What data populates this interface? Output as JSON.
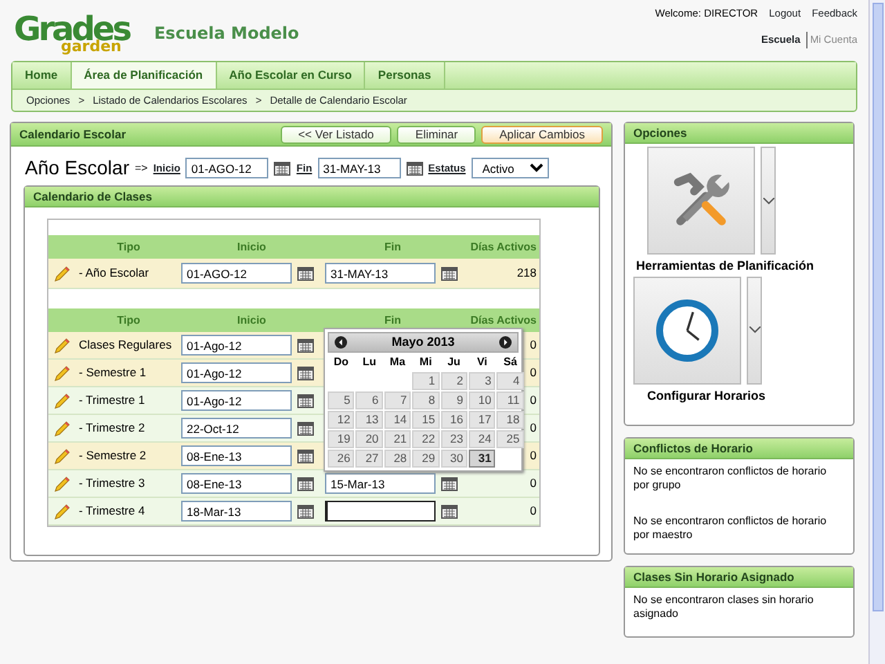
{
  "header": {
    "logo_top": "Grades",
    "logo_bottom": "garden",
    "school": "Escuela Modelo",
    "welcome": "Welcome: DIRECTOR",
    "links": [
      "Logout",
      "Feedback"
    ],
    "switch": [
      {
        "label": "Escuela",
        "selected": true
      },
      {
        "label": "Mi Cuenta",
        "selected": false
      }
    ]
  },
  "tabs": [
    {
      "label": "Home",
      "selected": false
    },
    {
      "label": "Área de Planificación",
      "selected": true
    },
    {
      "label": "Año Escolar en Curso",
      "selected": false
    },
    {
      "label": "Personas",
      "selected": false
    }
  ],
  "breadcrumb": {
    "items": [
      "Opciones",
      "Listado de Calendarios Escolares",
      "Detalle de Calendario Escolar"
    ],
    "separators": [
      ">",
      ">"
    ]
  },
  "main": {
    "title": "Calendario Escolar",
    "buttons": [
      {
        "label": "<< Ver Listado",
        "kind": "plain"
      },
      {
        "label": "Eliminar",
        "kind": "plain"
      },
      {
        "label": "Aplicar Cambios",
        "kind": "primary"
      }
    ],
    "year": {
      "label": "Año Escolar",
      "arrow": "=>",
      "inicio_label": "Inicio",
      "inicio": "01-AGO-12",
      "fin_label": "Fin",
      "fin": "31-MAY-13",
      "estatus_label": "Estatus",
      "estatus": "Activo"
    },
    "calendar": {
      "title": "Calendario de Clases",
      "columns": [
        "Tipo",
        "Inicio",
        "Fin",
        "Días Activos"
      ],
      "year_row": {
        "tipo": "- Año Escolar",
        "inicio": "01-AGO-12",
        "fin": "31-MAY-13",
        "dias": "218"
      },
      "columns_2": [
        "Tipo",
        "Inicio",
        "Fin",
        "Días Activos"
      ],
      "periods": [
        {
          "tipo": "Clases Regulares",
          "inicio": "01-Ago-12",
          "dias": "0",
          "kind": "semester"
        },
        {
          "tipo": "- Semestre 1",
          "inicio": "01-Ago-12",
          "dias": "0",
          "kind": "semester"
        },
        {
          "tipo": "- Trimestre 1",
          "inicio": "01-Ago-12",
          "dias": "0",
          "kind": "trimester"
        },
        {
          "tipo": "- Trimestre 2",
          "inicio": "22-Oct-12",
          "dias": "0",
          "kind": "trimester"
        },
        {
          "tipo": "- Semestre 2",
          "inicio": "08-Ene-13",
          "dias": "0",
          "kind": "semester"
        },
        {
          "tipo": "- Trimestre 3",
          "inicio": "08-Ene-13",
          "fin": "15-Mar-13",
          "dias": "0",
          "kind": "trimester"
        },
        {
          "tipo": "- Trimestre 4",
          "inicio": "18-Mar-13",
          "dias": "0",
          "kind": "trimester",
          "focused": true
        }
      ],
      "datepicker": {
        "month": "Mayo 2013",
        "weekdays": [
          "Do",
          "Lu",
          "Ma",
          "Mi",
          "Ju",
          "Vi",
          "Sá"
        ],
        "weeks": [
          [
            {
              "kind": "blank"
            },
            {
              "kind": "blank"
            },
            {
              "kind": "blank"
            },
            {
              "kind": "day",
              "day": "1",
              "selected": false
            },
            {
              "kind": "day",
              "day": "2",
              "selected": false
            },
            {
              "kind": "day",
              "day": "3",
              "selected": false
            },
            {
              "kind": "day",
              "day": "4",
              "selected": false
            }
          ],
          [
            {
              "kind": "day",
              "day": "5",
              "selected": false
            },
            {
              "kind": "day",
              "day": "6",
              "selected": false
            },
            {
              "kind": "day",
              "day": "7",
              "selected": false
            },
            {
              "kind": "day",
              "day": "8",
              "selected": false
            },
            {
              "kind": "day",
              "day": "9",
              "selected": false
            },
            {
              "kind": "day",
              "day": "10",
              "selected": false
            },
            {
              "kind": "day",
              "day": "11",
              "selected": false
            }
          ],
          [
            {
              "kind": "day",
              "day": "12",
              "selected": false
            },
            {
              "kind": "day",
              "day": "13",
              "selected": false
            },
            {
              "kind": "day",
              "day": "14",
              "selected": false
            },
            {
              "kind": "day",
              "day": "15",
              "selected": false
            },
            {
              "kind": "day",
              "day": "16",
              "selected": false
            },
            {
              "kind": "day",
              "day": "17",
              "selected": false
            },
            {
              "kind": "day",
              "day": "18",
              "selected": false
            }
          ],
          [
            {
              "kind": "day",
              "day": "19",
              "selected": false
            },
            {
              "kind": "day",
              "day": "20",
              "selected": false
            },
            {
              "kind": "day",
              "day": "21",
              "selected": false
            },
            {
              "kind": "day",
              "day": "22",
              "selected": false
            },
            {
              "kind": "day",
              "day": "23",
              "selected": false
            },
            {
              "kind": "day",
              "day": "24",
              "selected": false
            },
            {
              "kind": "day",
              "day": "25",
              "selected": false
            }
          ],
          [
            {
              "kind": "day",
              "day": "26",
              "selected": false
            },
            {
              "kind": "day",
              "day": "27",
              "selected": false
            },
            {
              "kind": "day",
              "day": "28",
              "selected": false
            },
            {
              "kind": "day",
              "day": "29",
              "selected": false
            },
            {
              "kind": "day",
              "day": "30",
              "selected": false
            },
            {
              "kind": "day",
              "day": "31",
              "selected": true
            }
          ]
        ]
      }
    }
  },
  "options": {
    "title": "Opciones",
    "items": [
      {
        "label": "Herramientas de Planificación",
        "kind": "tools"
      },
      {
        "label": "Configurar Horarios",
        "kind": "clock"
      }
    ]
  },
  "conflicts": {
    "title": "Conflictos de Horario",
    "messages": [
      "No se encontraron conflictos de horario por grupo",
      "No se encontraron conflictos de horario por maestro"
    ]
  },
  "unassigned": {
    "title": "Clases Sin Horario Asignado",
    "messages": [
      "No se encontraron clases sin horario asignado"
    ]
  }
}
